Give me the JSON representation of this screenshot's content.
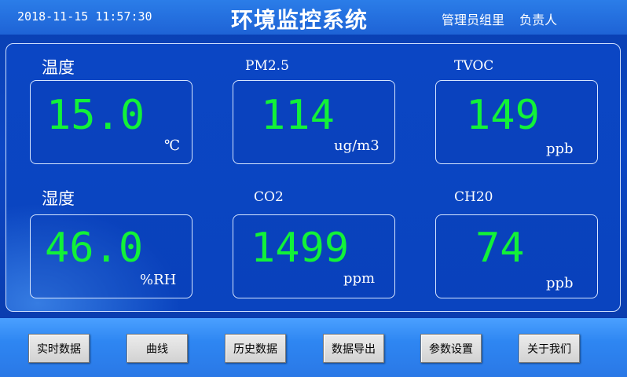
{
  "header": {
    "datetime": "2018-11-15 11:57:30",
    "title": "环境监控系统",
    "admin_label": "管理员组里",
    "responsible_label": "负责人"
  },
  "sensors": [
    {
      "label": "温度",
      "value": "15.0",
      "unit": "℃"
    },
    {
      "label": "PM2.5",
      "value": "114",
      "unit": "ug/m3"
    },
    {
      "label": "TVOC",
      "value": "149",
      "unit": "ppb"
    },
    {
      "label": "湿度",
      "value": "46.0",
      "unit": "%RH"
    },
    {
      "label": "CO2",
      "value": "1499",
      "unit": "ppm"
    },
    {
      "label": "CH20",
      "value": "74",
      "unit": "ppb"
    }
  ],
  "buttons": [
    {
      "label": "实时数据"
    },
    {
      "label": "曲线"
    },
    {
      "label": "历史数据"
    },
    {
      "label": "数据导出"
    },
    {
      "label": "参数设置"
    },
    {
      "label": "关于我们"
    }
  ],
  "colors": {
    "value": "#12f238",
    "background": "#0b46c4",
    "header": "#1e63d6"
  }
}
